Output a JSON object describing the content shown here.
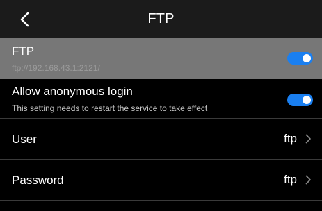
{
  "header": {
    "title": "FTP",
    "back_icon": "chevron-left-icon"
  },
  "ftp": {
    "label": "FTP",
    "address": "ftp://192.168.43.1:2121/",
    "enabled": true
  },
  "anonymous": {
    "label": "Allow anonymous login",
    "note": "This setting needs to restart the service to take effect",
    "enabled": true
  },
  "user": {
    "label": "User",
    "value": "ftp",
    "icon": "chevron-right-icon"
  },
  "password": {
    "label": "Password",
    "value": "ftp",
    "icon": "chevron-right-icon"
  },
  "colors": {
    "toggle_on": "#1a7ff0",
    "highlight_row": "#777777",
    "header_bg": "#1b1b1b",
    "background": "#000000"
  }
}
